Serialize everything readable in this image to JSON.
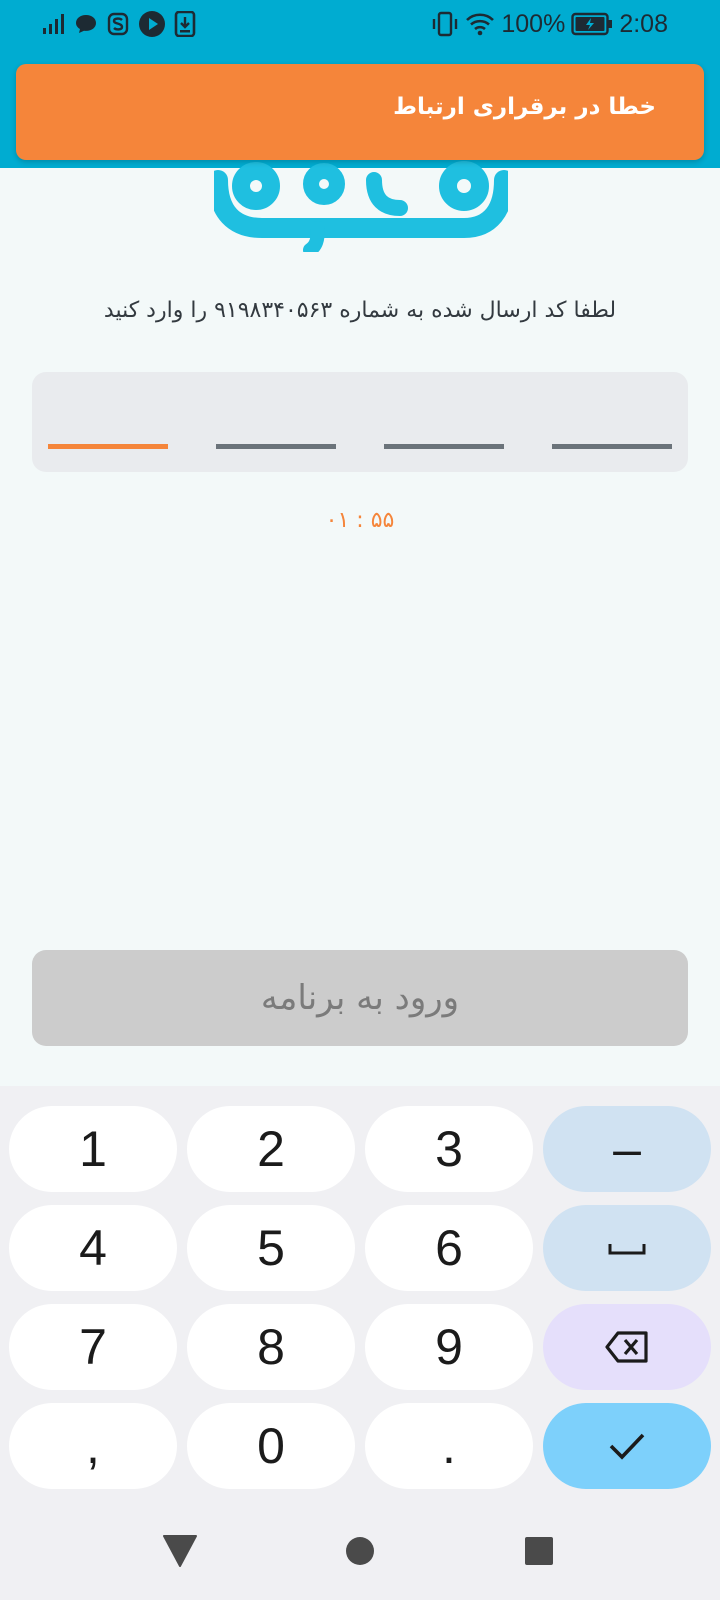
{
  "status_bar": {
    "battery": "100%",
    "time": "2:08",
    "icons": [
      "signal-icon",
      "message-icon",
      "s-app-icon",
      "play-app-icon",
      "download-icon",
      "vibrate-icon",
      "wifi-icon",
      "battery-charging-icon"
    ]
  },
  "toast": {
    "message": "خطا در برقراری ارتباط"
  },
  "logo": {
    "name": "همراه"
  },
  "verify": {
    "instruction": "لطفا کد ارسال شده به شماره ۹۱۹۸۳۴۰۵۶۳ را وارد کنید",
    "code_length": 4,
    "active_slot": 0,
    "timer": "۰۱ : ۵۵",
    "login_label": "ورود به برنامه"
  },
  "keyboard": {
    "keys": [
      "1",
      "2",
      "3",
      "–",
      "4",
      "5",
      "6",
      "␣",
      "7",
      "8",
      "9",
      "⌫",
      ",",
      "0",
      ".",
      "✓"
    ]
  },
  "colors": {
    "statusbar": "#00acd1",
    "toast": "#f5853a",
    "accent": "#f5853a",
    "logo": "#1fbfe0"
  },
  "nav": {
    "icons": [
      "back-icon",
      "home-icon",
      "recents-icon"
    ]
  }
}
